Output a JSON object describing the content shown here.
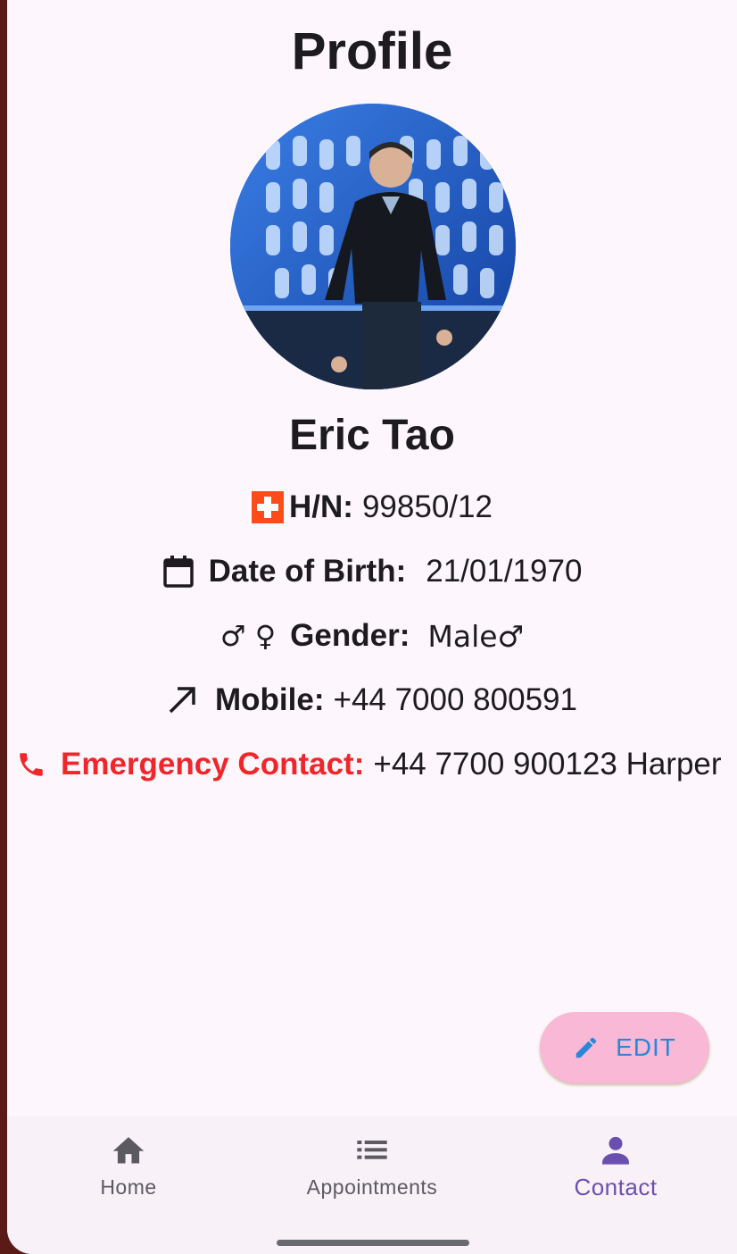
{
  "header": {
    "title": "Profile"
  },
  "profile": {
    "name": "Eric Tao",
    "fields": {
      "hn": {
        "label": "H/N:",
        "value": "99850/12"
      },
      "dob": {
        "label": "Date of Birth:",
        "value": "21/01/1970"
      },
      "gender": {
        "label": "Gender:",
        "value": "Male♂",
        "icon_text": "♂ ♀"
      },
      "mobile": {
        "label": "Mobile:",
        "value": "+44 7000 800591"
      },
      "emergency": {
        "label": "Emergency Contact:",
        "value": "+44 7700 900123 Harper"
      }
    }
  },
  "fab": {
    "label": "EDIT",
    "icon": "pencil-icon"
  },
  "bottom_nav": {
    "items": [
      {
        "label": "Home",
        "icon": "home-icon"
      },
      {
        "label": "Appointments",
        "icon": "list-icon"
      },
      {
        "label": "Contact",
        "icon": "person-icon",
        "active": true
      }
    ]
  },
  "colors": {
    "background": "#fdf7fd",
    "emergency_label": "#f0262b",
    "fab_background": "#f8b8d6",
    "fab_text": "#2a86d8",
    "nav_active": "#6a4fb0",
    "hn_icon": "#ff4a1a"
  }
}
